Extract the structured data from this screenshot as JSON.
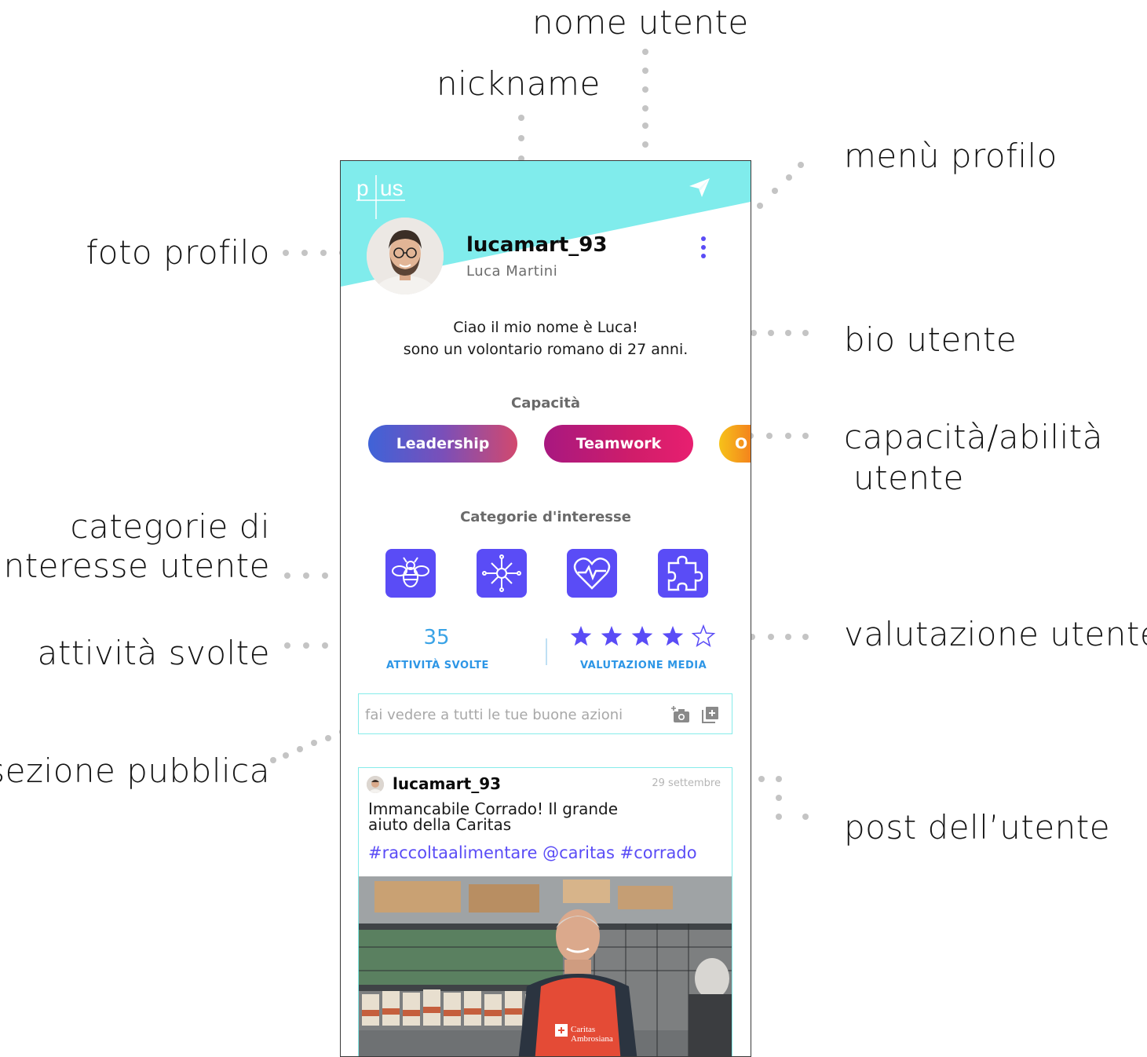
{
  "annotations": {
    "nome_utente": "nome utente",
    "nickname": "nickname",
    "menu_profilo": "menù profilo",
    "foto_profilo": "foto profilo",
    "bio_utente": "bio utente",
    "capacita_line1": "capacità/abilità",
    "capacita_line2": "utente",
    "categorie_line1": "categorie di",
    "categorie_line2": "interesse utente",
    "valutazione_utente": "valutazione utente",
    "attivita_svolte": "attività svolte",
    "sezione_pubblica": "sezione pubblica",
    "post_utente": "post dell’utente"
  },
  "app": {
    "logo_text": "plus",
    "colors": {
      "header": "#80ecec",
      "accent": "#5a4cf6",
      "stats": "#2d96e6"
    }
  },
  "profile": {
    "username": "lucamart_93",
    "full_name": "Luca Martini",
    "bio_line1": "Ciao il mio nome è Luca!",
    "bio_line2": "sono un volontario romano di 27 anni."
  },
  "skills": {
    "title": "Capacità",
    "items": [
      "Leadership",
      "Teamwork",
      "O"
    ]
  },
  "interests": {
    "title": "Categorie d'interesse",
    "icons": [
      "bee-icon",
      "splash-icon",
      "heart-pulse-icon",
      "puzzle-icon"
    ]
  },
  "stats": {
    "activities_count": "35",
    "activities_label": "ATTIVITÀ SVOLTE",
    "rating_label": "VALUTAZIONE MEDIA",
    "rating_stars_filled": 4,
    "rating_stars_total": 5
  },
  "composer": {
    "placeholder": "fai vedere a tutti le tue buone azioni"
  },
  "post": {
    "username": "lucamart_93",
    "date": "29 settembre",
    "text_line1": "Immancabile Corrado! Il grande",
    "text_line2": "aiuto della Caritas",
    "hashtags": "#raccoltaalimentare @caritas #corrado",
    "photo_caption_1": "Caritas",
    "photo_caption_2": "Ambrosiana"
  }
}
